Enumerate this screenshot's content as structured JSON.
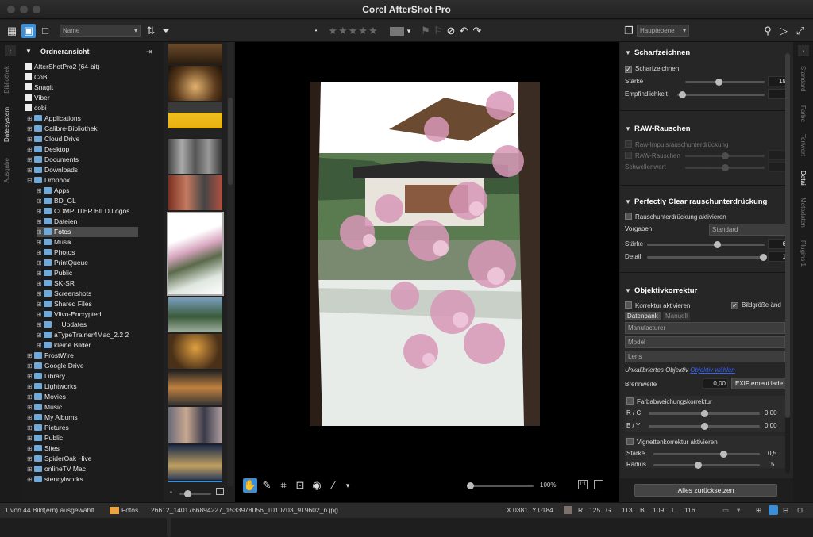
{
  "window": {
    "title": "Corel AfterShot Pro"
  },
  "toolbar": {
    "sort_dropdown": "Name",
    "layer_dropdown": "Hauptebene"
  },
  "left_tabs": [
    "Bibliothek",
    "Dateisystem",
    "Ausgabe"
  ],
  "tree": {
    "header": "Ordneransicht",
    "items": [
      {
        "label": "AfterShotPro2 (64-bit)",
        "indent": 0,
        "icon": "drive"
      },
      {
        "label": "CoBi",
        "indent": 0,
        "icon": "drive"
      },
      {
        "label": "Snagit",
        "indent": 0,
        "icon": "drive"
      },
      {
        "label": "Viber",
        "indent": 0,
        "icon": "drive"
      },
      {
        "label": "cobi",
        "indent": 0,
        "icon": "home",
        "expanded": true
      },
      {
        "label": "Applications",
        "indent": 1
      },
      {
        "label": "Calibre-Bibliothek",
        "indent": 1
      },
      {
        "label": "Cloud Drive",
        "indent": 1
      },
      {
        "label": "Desktop",
        "indent": 1
      },
      {
        "label": "Documents",
        "indent": 1
      },
      {
        "label": "Downloads",
        "indent": 1
      },
      {
        "label": "Dropbox",
        "indent": 1,
        "expanded": true
      },
      {
        "label": "Apps",
        "indent": 2
      },
      {
        "label": "BD_GL",
        "indent": 2
      },
      {
        "label": "COMPUTER BILD Logos",
        "indent": 2
      },
      {
        "label": "Dateien",
        "indent": 2
      },
      {
        "label": "Fotos",
        "indent": 2,
        "selected": true
      },
      {
        "label": "Musik",
        "indent": 2
      },
      {
        "label": "Photos",
        "indent": 2
      },
      {
        "label": "PrintQueue",
        "indent": 2
      },
      {
        "label": "Public",
        "indent": 2
      },
      {
        "label": "SK-SR",
        "indent": 2
      },
      {
        "label": "Screenshots",
        "indent": 2
      },
      {
        "label": "Shared Files",
        "indent": 2
      },
      {
        "label": "Vlivo-Encrypted",
        "indent": 2
      },
      {
        "label": "__Updates",
        "indent": 2
      },
      {
        "label": "aTypeTrainer4Mac_2.2 2",
        "indent": 2
      },
      {
        "label": "kleine Bilder",
        "indent": 2
      },
      {
        "label": "FrostWire",
        "indent": 1
      },
      {
        "label": "Google Drive",
        "indent": 1
      },
      {
        "label": "Library",
        "indent": 1
      },
      {
        "label": "Lightworks",
        "indent": 1
      },
      {
        "label": "Movies",
        "indent": 1
      },
      {
        "label": "Music",
        "indent": 1
      },
      {
        "label": "My Albums",
        "indent": 1
      },
      {
        "label": "Pictures",
        "indent": 1
      },
      {
        "label": "Public",
        "indent": 1
      },
      {
        "label": "Sites",
        "indent": 1
      },
      {
        "label": "SpiderOak Hive",
        "indent": 1
      },
      {
        "label": "onlineTV Mac",
        "indent": 1
      },
      {
        "label": "stencylworks",
        "indent": 1
      }
    ]
  },
  "viewer": {
    "zoom": "100%"
  },
  "right": {
    "sharpen": {
      "title": "Scharfzeichnen",
      "enable": "Scharfzeichnen",
      "strength_label": "Stärke",
      "strength_val": "19",
      "sens_label": "Empfindlichkeit"
    },
    "raw_noise": {
      "title": "RAW-Rauschen",
      "impulse": "Raw-Impulsrauschunterdrückung",
      "raw_noise": "RAW-Rauschen",
      "threshold": "Schwellenwert"
    },
    "perfectly_clear": {
      "title": "Perfectly Clear rauschunterdrückung",
      "enable": "Rauschunterdrückung aktivieren",
      "presets_label": "Vorgaben",
      "presets_val": "Standard",
      "strength_label": "Stärke",
      "strength_val": "6",
      "detail_label": "Detail",
      "detail_val": "1"
    },
    "lens": {
      "title": "Objektivkorrektur",
      "enable": "Korrektur aktivieren",
      "resize": "Bildgröße änd",
      "tab_db": "Datenbank",
      "tab_manual": "Manuell",
      "manufacturer": "Manufacturer",
      "model": "Model",
      "lens": "Lens",
      "uncal": "Unkalibriertes Objektiv",
      "link": "Objektiv wählen",
      "focal_label": "Brennweite",
      "focal_val": "0,00",
      "exif_btn": "EXIF erneut lade"
    },
    "ca": {
      "title": "Farbabweichungskorrektur",
      "rc": "R / C",
      "rc_val": "0,00",
      "by": "B / Y",
      "by_val": "0,00"
    },
    "vignette": {
      "title": "Vignettenkorrektur aktivieren",
      "strength_label": "Stärke",
      "strength_val": "0,5",
      "radius_label": "Radius",
      "radius_val": "5"
    },
    "reset": "Alles zurücksetzen"
  },
  "right_tabs": [
    "Standard",
    "Farbe",
    "Tonwert",
    "Detail",
    "Metadaten",
    "Plugins 1"
  ],
  "status": {
    "count": "1 von 44 Bild(ern) ausgewählt",
    "folder": "Fotos",
    "file": "26612_1401766894227_1533978056_1010703_919602_n.jpg",
    "x": "X 0381",
    "y": "Y 0184",
    "r_label": "R",
    "r": "125",
    "g_label": "G",
    "g": "113",
    "b_label": "B",
    "b": "109",
    "l_label": "L",
    "l": "116"
  }
}
